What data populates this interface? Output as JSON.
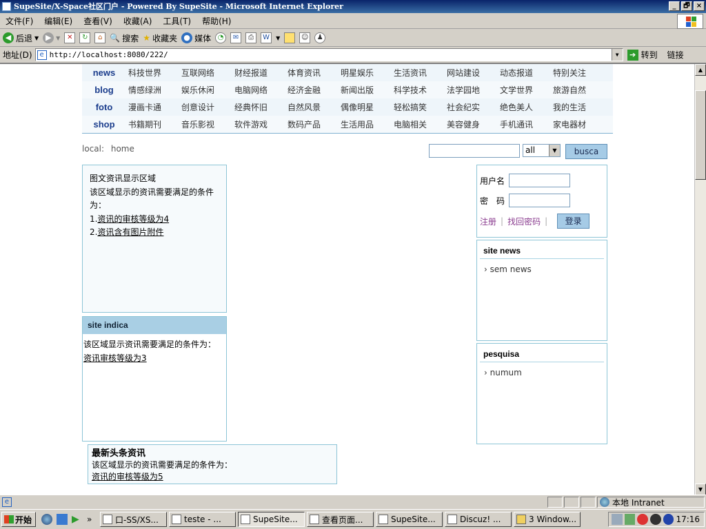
{
  "window": {
    "title": "SupeSite/X-Space社区门户 - Powered By SupeSite - Microsoft Internet Explorer",
    "buttons": [
      "_",
      "🗗",
      "×"
    ]
  },
  "menu": [
    "文件(F)",
    "编辑(E)",
    "查看(V)",
    "收藏(A)",
    "工具(T)",
    "帮助(H)"
  ],
  "toolbar": {
    "back": "后退",
    "search": "搜索",
    "favorites": "收藏夹",
    "media": "媒体"
  },
  "address": {
    "label": "地址(D)",
    "url": "http://localhost:8080/222/",
    "go": "转到",
    "links": "链接"
  },
  "nav": {
    "rows": [
      {
        "cat": "news",
        "subs": [
          "科技世界",
          "互联网络",
          "财经报道",
          "体育资讯",
          "明星娱乐",
          "生活资讯",
          "网站建设",
          "动态报道",
          "特别关注"
        ]
      },
      {
        "cat": "blog",
        "subs": [
          "情感绿洲",
          "娱乐休闲",
          "电脑网络",
          "经济金融",
          "新闻出版",
          "科学技术",
          "法学园地",
          "文学世界",
          "旅游自然"
        ]
      },
      {
        "cat": "foto",
        "subs": [
          "漫画卡通",
          "创意设计",
          "经典怀旧",
          "自然风景",
          "偶像明星",
          "轻松搞笑",
          "社会纪实",
          "绝色美人",
          "我的生活"
        ]
      },
      {
        "cat": "shop",
        "subs": [
          "书籍期刊",
          "音乐影视",
          "软件游戏",
          "数码产品",
          "生活用品",
          "电脑相关",
          "美容健身",
          "手机通讯",
          "家电器材"
        ]
      }
    ]
  },
  "breadcrumb": {
    "label": "local:",
    "home": "home"
  },
  "search": {
    "input_value": "",
    "select_value": "all",
    "button": "busca"
  },
  "block1": {
    "line1": "图文资讯显示区域",
    "line2": "该区域显示的资讯需要满足的条件为：",
    "cond1_prefix": "1.",
    "cond1": "资讯的审核等级为4",
    "cond2_prefix": "2.",
    "cond2": "资讯含有图片附件"
  },
  "block2": {
    "title": "site indica",
    "line1": "该区域显示资讯需要满足的条件为：",
    "cond": "资讯审核等级为3"
  },
  "block3": {
    "title": "最新头条资讯",
    "line1": "该区域显示的资讯需要满足的条件为：",
    "cond": "资讯的审核等级为5"
  },
  "login": {
    "username_label": "用户名",
    "password_label": "密　码",
    "register": "注册",
    "forgot": "找回密码",
    "button": "登录"
  },
  "site_news": {
    "title": "site news",
    "item": "› sem news"
  },
  "pesquisa": {
    "title": "pesquisa",
    "item": "› numum"
  },
  "status": {
    "zone": "本地 Intranet"
  },
  "taskbar": {
    "start": "开始",
    "tasks": [
      "口-SS/XS...",
      "teste - ...",
      "SupeSite...",
      "查看页面...",
      "SupeSite...",
      "Discuz! ...",
      "3 Window..."
    ],
    "more": "»",
    "clock": "17:16"
  },
  "colors": {
    "accent": "#a6cbe6",
    "border": "#8cc4d6",
    "nav_cat": "#1a3c8c"
  }
}
